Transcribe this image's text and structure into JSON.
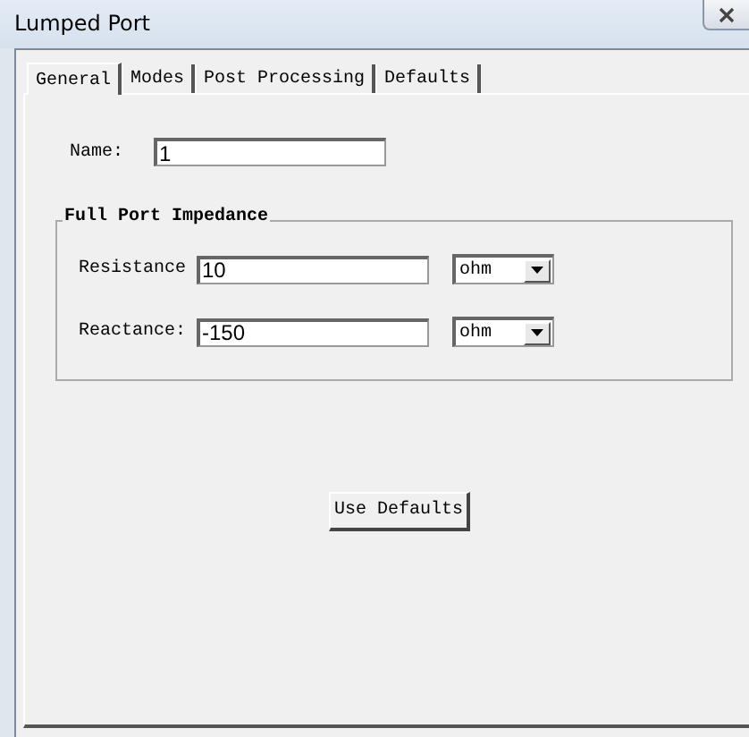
{
  "window": {
    "title": "Lumped Port"
  },
  "tabs": [
    {
      "label": "General",
      "selected": true
    },
    {
      "label": "Modes",
      "selected": false
    },
    {
      "label": "Post Processing",
      "selected": false
    },
    {
      "label": "Defaults",
      "selected": false
    }
  ],
  "name": {
    "label": "Name:",
    "value": "1"
  },
  "impedance": {
    "title": "Full Port Impedance",
    "rows": [
      {
        "label": "Resistance",
        "value": "10",
        "unit": "ohm"
      },
      {
        "label": "Reactance:",
        "value": "-150",
        "unit": "ohm"
      }
    ]
  },
  "buttons": [
    "Use Defaults"
  ]
}
